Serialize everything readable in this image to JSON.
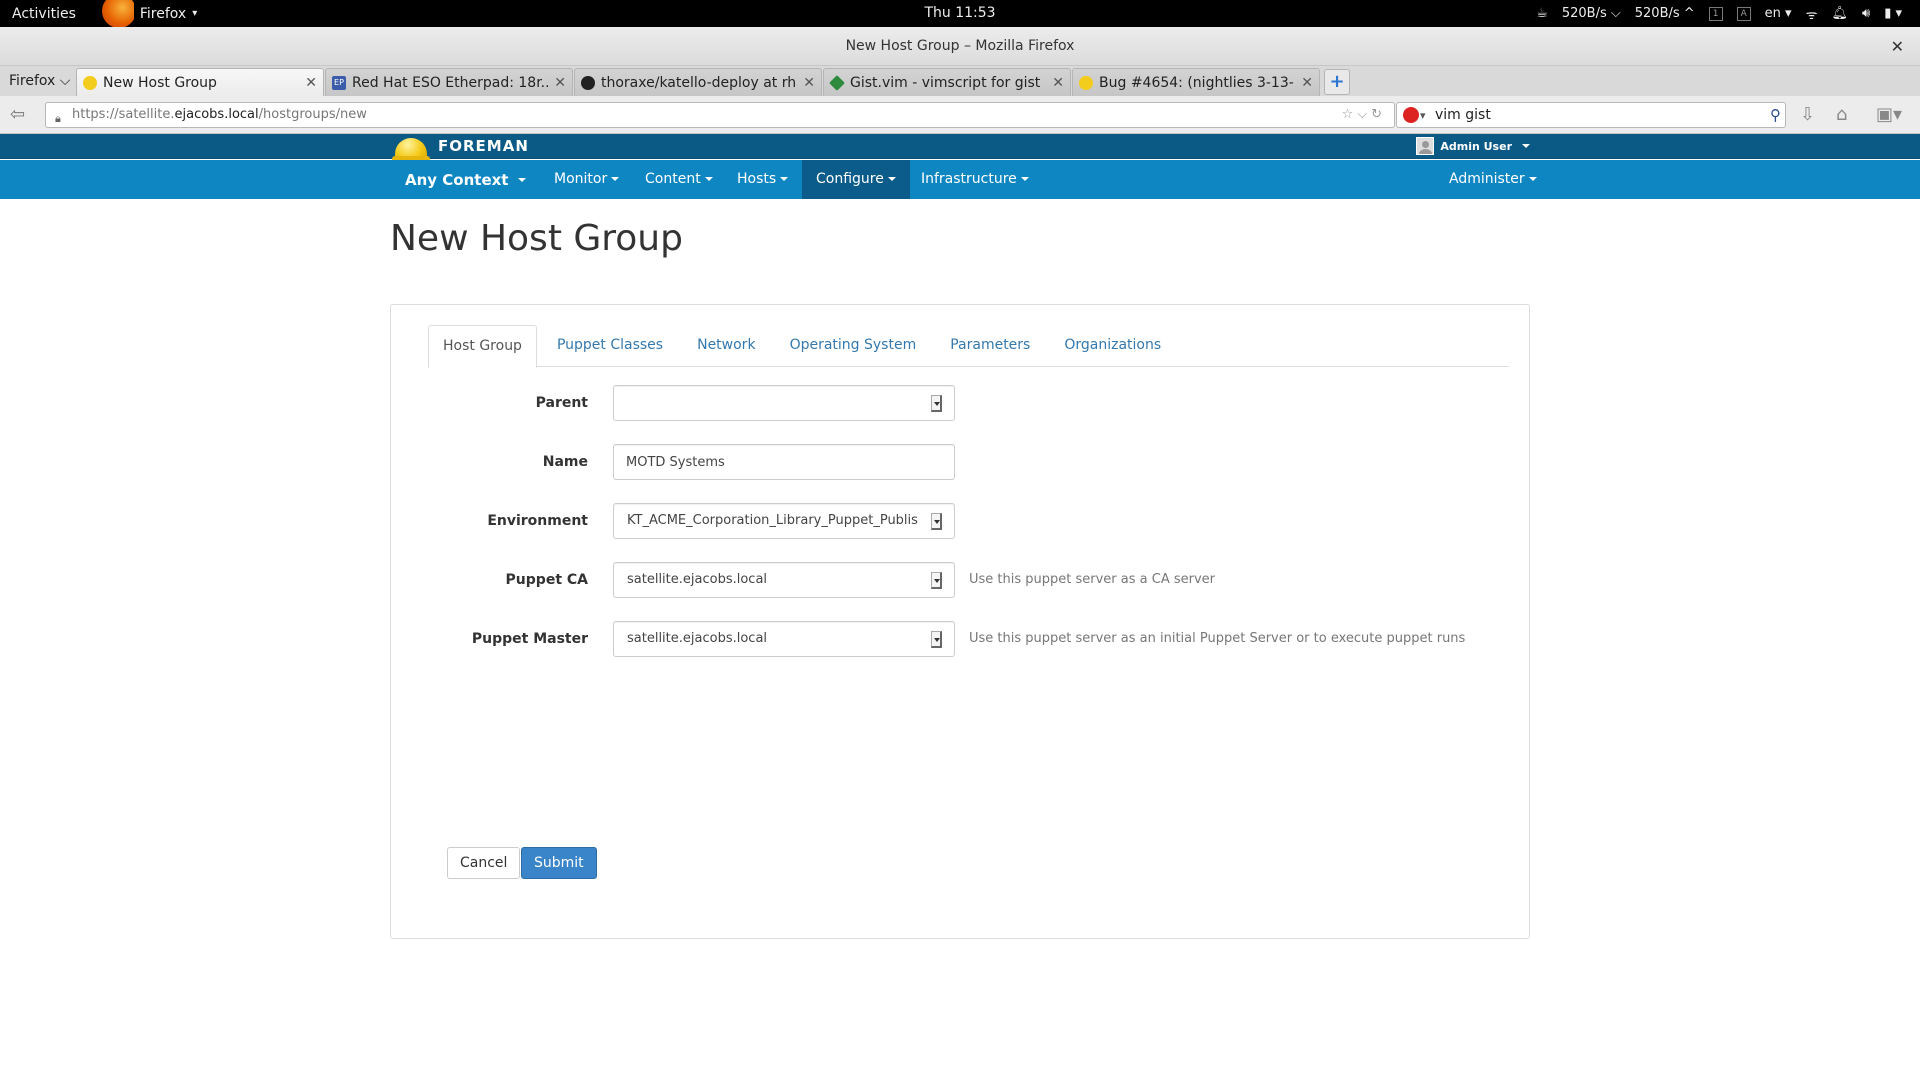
{
  "system": {
    "activities": "Activities",
    "app_menu": "Firefox",
    "clock": "Thu 11:53",
    "net_down": "520B/s",
    "net_up": "520B/s",
    "kbd_1": "1",
    "kbd_a": "A",
    "lang": "en"
  },
  "window": {
    "title": "New Host Group – Mozilla Firefox"
  },
  "browser": {
    "menu_button": "Firefox",
    "tabs": [
      {
        "label": "New Host Group",
        "active": true,
        "favicon_color": "#f4cc1b"
      },
      {
        "label": "Red Hat ESO Etherpad: 18r...",
        "active": false,
        "favicon_color": "#3b5ca8"
      },
      {
        "label": "thoraxe/katello-deploy at rh...",
        "active": false,
        "favicon_color": "#222222"
      },
      {
        "label": "Gist.vim - vimscript for gist : ...",
        "active": false,
        "favicon_color": "#2e8b3d"
      },
      {
        "label": "Bug #4654: (nightlies 3-13-...",
        "active": false,
        "favicon_color": "#f4cc1b"
      }
    ],
    "url_prefix": "https://satellite.",
    "url_host": "ejacobs.local",
    "url_path": "/hostgroups/new",
    "search_value": "vim gist"
  },
  "foreman": {
    "brand": "FOREMAN",
    "user": "Admin User",
    "context": "Any Context",
    "menus": [
      "Monitor",
      "Content",
      "Hosts",
      "Configure",
      "Infrastructure"
    ],
    "active_menu": "Configure",
    "admin_menu": "Administer"
  },
  "page": {
    "title": "New Host Group",
    "tabs": [
      "Host Group",
      "Puppet Classes",
      "Network",
      "Operating System",
      "Parameters",
      "Organizations"
    ],
    "active_tab": "Host Group",
    "form": {
      "parent_label": "Parent",
      "parent_value": "",
      "name_label": "Name",
      "name_value": "MOTD Systems",
      "environment_label": "Environment",
      "environment_value": "KT_ACME_Corporation_Library_Puppet_Publis",
      "puppet_ca_label": "Puppet CA",
      "puppet_ca_value": "satellite.ejacobs.local",
      "puppet_ca_help": "Use this puppet server as a CA server",
      "puppet_master_label": "Puppet Master",
      "puppet_master_value": "satellite.ejacobs.local",
      "puppet_master_help": "Use this puppet server as an initial Puppet Server or to execute puppet runs"
    },
    "cancel_label": "Cancel",
    "submit_label": "Submit"
  },
  "colors": {
    "header_dark": "#0b5a86",
    "nav_blue": "#0e86c2",
    "link_blue": "#3478ad",
    "primary_button": "#3a84c9"
  }
}
